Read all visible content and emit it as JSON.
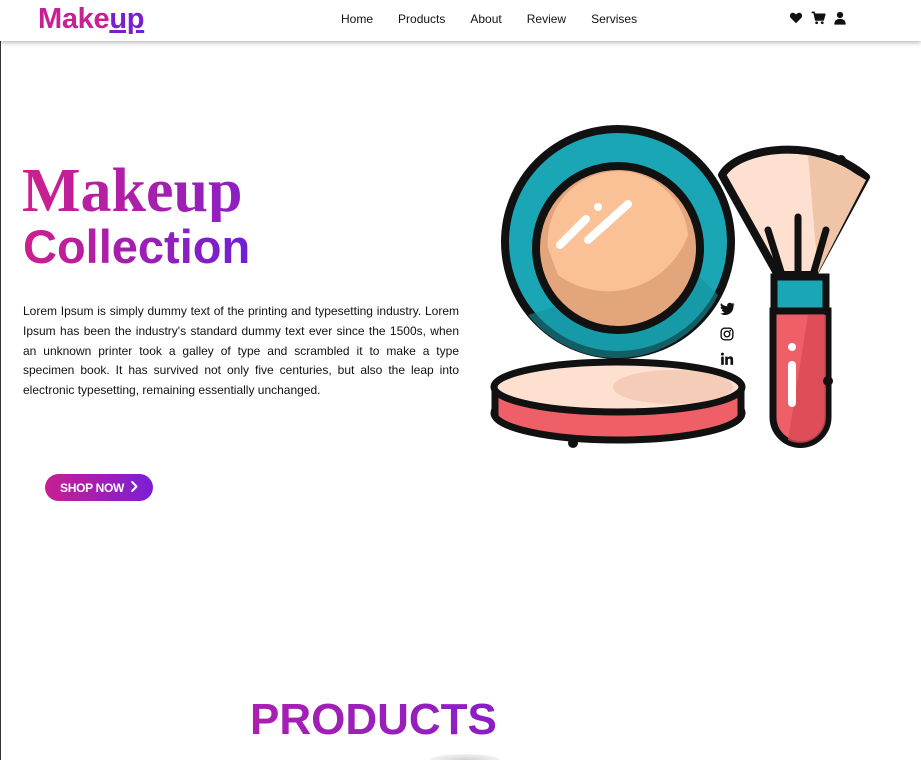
{
  "header": {
    "logo_main": "Make",
    "logo_accent": "up",
    "nav": [
      "Home",
      "Products",
      "About",
      "Review",
      "Servises"
    ],
    "icons": [
      "heart-icon",
      "cart-icon",
      "user-icon"
    ]
  },
  "hero": {
    "title": "Makeup",
    "subtitle": "Collection",
    "text": "Lorem Ipsum is simply dummy text of the printing and typesetting industry. Lorem Ipsum has been the industry's standard dummy text ever since the 1500s, when an unknown printer took a galley of type and scrambled it to make a type specimen book. It has survived not only five centuries, but also the leap into electronic typesetting, remaining essentially unchanged.",
    "button_label": "SHOP NOW"
  },
  "social": [
    "twitter-icon",
    "instagram-icon",
    "linkedin-icon"
  ],
  "products": {
    "title": "PRODUCTS"
  },
  "colors": {
    "brand_pink": "#c91f94",
    "brand_purple": "#7a1fd0",
    "compact_teal": "#1aa6b4",
    "powder": "#fbc196",
    "brush_red": "#ef5f67"
  }
}
